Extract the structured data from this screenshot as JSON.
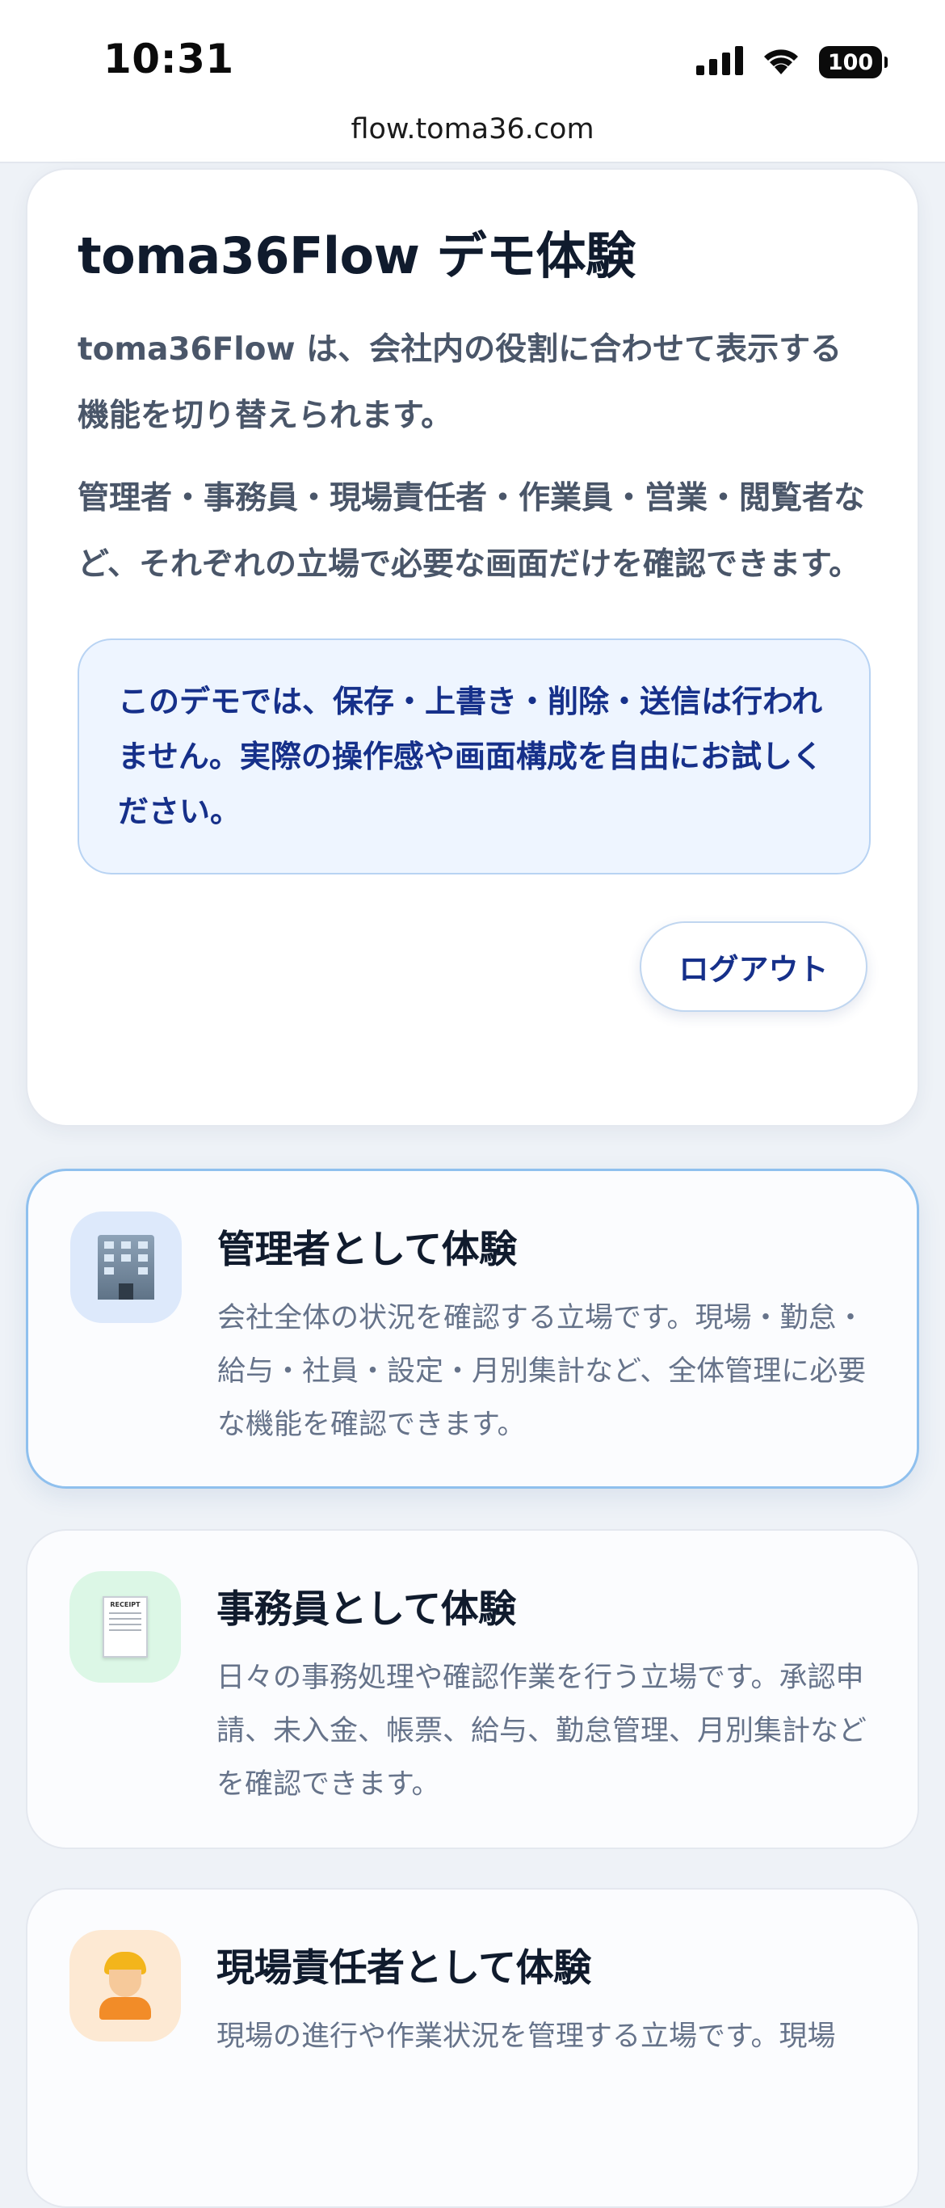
{
  "status_bar": {
    "time": "10:31",
    "battery": "100"
  },
  "browser": {
    "url": "flow.toma36.com"
  },
  "intro": {
    "title": "toma36Flow デモ体験",
    "paragraph1": "toma36Flow は、会社内の役割に合わせて表示する機能を切り替えられます。",
    "paragraph2": "管理者・事務員・現場責任者・作業員・営業・閲覧者など、それぞれの立場で必要な画面だけを確認できます。",
    "notice": "このデモでは、保存・上書き・削除・送信は行われません。実際の操作感や画面構成を自由にお試しください。",
    "logout_label": "ログアウト"
  },
  "roles": [
    {
      "icon": "office-building-icon",
      "title": "管理者として体験",
      "description": "会社全体の状況を確認する立場です。現場・勤怠・給与・社員・設定・月別集計など、全体管理に必要な機能を確認できます。",
      "icon_bg": "#dde9fb"
    },
    {
      "icon": "receipt-icon",
      "receipt_text": "RECEIPT",
      "title": "事務員として体験",
      "description": "日々の事務処理や確認作業を行う立場です。承認申請、未入金、帳票、給与、勤怠管理、月別集計などを確認できます。",
      "icon_bg": "#dcf7e6"
    },
    {
      "icon": "construction-worker-icon",
      "title": "現場責任者として体験",
      "description": "現場の進行や作業状況を管理する立場です。現場",
      "icon_bg": "#fde9d3"
    }
  ],
  "colors": {
    "accent": "#16308a",
    "active_border": "#8fc0ee",
    "page_bg": "#eef2f7"
  }
}
